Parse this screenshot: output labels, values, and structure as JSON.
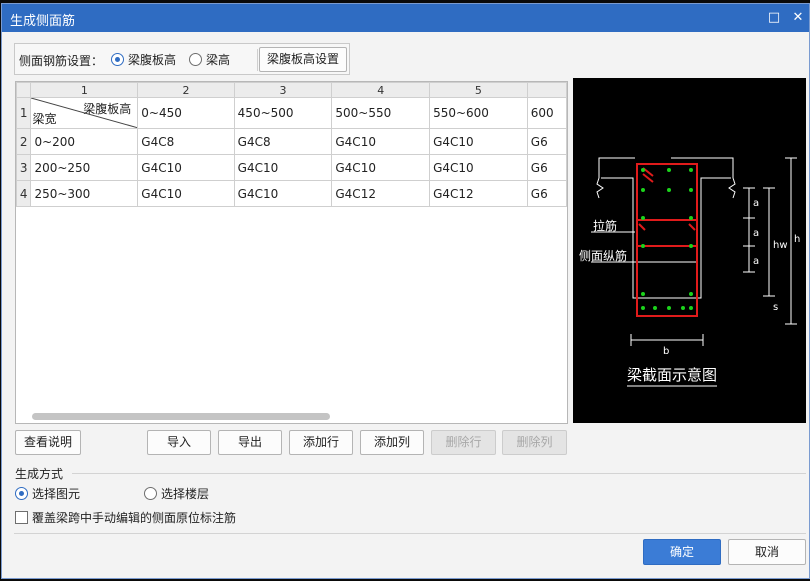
{
  "dialog": {
    "title": "生成侧面筋"
  },
  "settings": {
    "label": "侧面钢筋设置：",
    "options": [
      {
        "label": "梁腹板高",
        "selected": true
      },
      {
        "label": "梁高",
        "selected": false
      }
    ],
    "config_button": "梁腹板高设置"
  },
  "grid": {
    "col_headers": [
      "1",
      "2",
      "3",
      "4",
      "5"
    ],
    "corner": {
      "top_right": "梁腹板高",
      "bottom_left": "梁宽"
    },
    "col_ranges": [
      "0~450",
      "450~500",
      "500~550",
      "550~600",
      "600"
    ],
    "rows": [
      {
        "num": "1"
      },
      {
        "num": "2",
        "range": "0~200",
        "cells": [
          "G4C8",
          "G4C8",
          "G4C10",
          "G4C10",
          "G6"
        ]
      },
      {
        "num": "3",
        "range": "200~250",
        "cells": [
          "G4C10",
          "G4C10",
          "G4C10",
          "G4C10",
          "G6"
        ]
      },
      {
        "num": "4",
        "range": "250~300",
        "cells": [
          "G4C10",
          "G4C10",
          "G4C12",
          "G4C12",
          "G6"
        ]
      }
    ]
  },
  "diagram": {
    "caption": "梁截面示意图",
    "labels": {
      "tie": "拉筋",
      "side_long": "侧面纵筋",
      "a": "a",
      "hw": "hw",
      "h": "h",
      "s": "s",
      "b": "b"
    },
    "colors": {
      "section": "#e01b1b",
      "bars": "#1bd31b",
      "lines": "#ffffff"
    }
  },
  "actions": {
    "help": "查看说明",
    "import": "导入",
    "export": "导出",
    "add_row": "添加行",
    "add_col": "添加列",
    "del_row": "删除行",
    "del_col": "删除列"
  },
  "generate": {
    "section_title": "生成方式",
    "options": [
      {
        "label": "选择图元",
        "selected": true
      },
      {
        "label": "选择楼层",
        "selected": false
      }
    ],
    "override_label": "覆盖梁跨中手动编辑的侧面原位标注筋",
    "override_checked": false
  },
  "footer": {
    "ok": "确定",
    "cancel": "取消"
  },
  "colors": {
    "titlebar": "#2f6cc2",
    "primary": "#3b7cd6"
  }
}
